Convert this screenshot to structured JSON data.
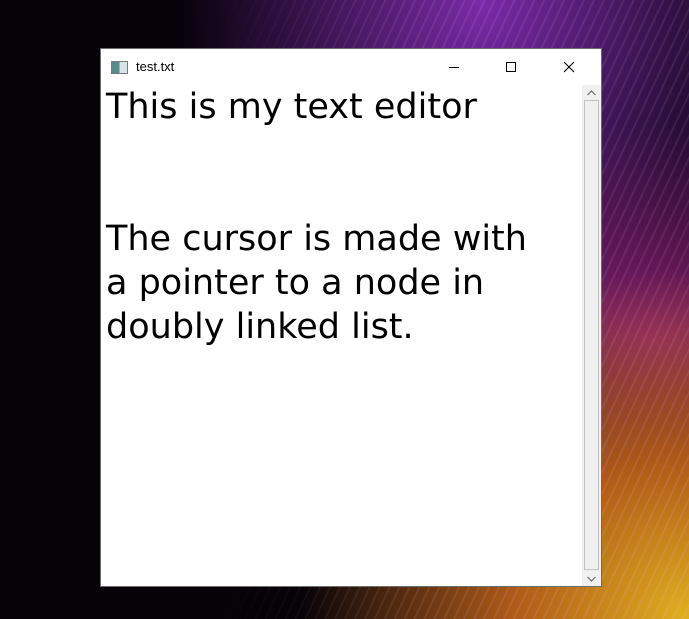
{
  "window": {
    "title": "test.txt",
    "controls": {
      "minimize": "minimize",
      "maximize": "maximize",
      "close": "close"
    }
  },
  "document": {
    "lines": [
      "This is my text editor",
      "",
      "",
      "The cursor is made with",
      "a pointer to a node in",
      "doubly linked list."
    ]
  },
  "icons": {
    "app": "app-window-icon",
    "minimize": "minimize-icon",
    "maximize": "maximize-icon",
    "close": "close-icon",
    "scroll_up": "chevron-up-icon",
    "scroll_down": "chevron-down-icon"
  }
}
